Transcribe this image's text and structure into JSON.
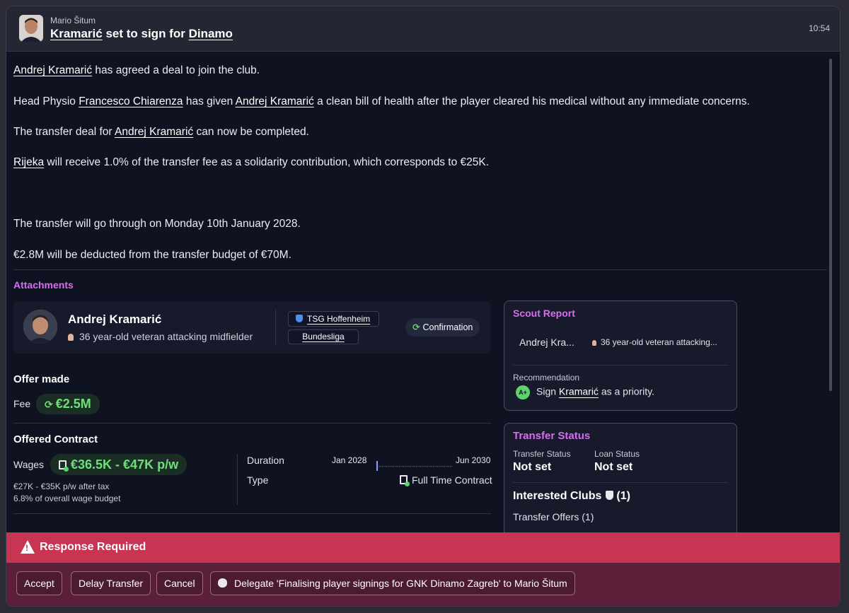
{
  "header": {
    "sender": "Mario Šitum",
    "title_player": "Kramarić",
    "title_middle": " set to sign for ",
    "title_club": "Dinamo",
    "time": "10:54"
  },
  "message": {
    "p1_link": "Andrej Kramarić",
    "p1_rest": " has agreed a deal to join the club.",
    "p2_pre": "Head Physio ",
    "p2_link1": "Francesco Chiarenza",
    "p2_mid": " has given ",
    "p2_link2": "Andrej Kramarić",
    "p2_rest": " a clean bill of health after the player cleared his medical without any immediate concerns.",
    "p3_pre": "The transfer deal for ",
    "p3_link": "Andrej Kramarić",
    "p3_rest": " can now be completed.",
    "p4_link": "Rijeka",
    "p4_rest": " will receive 1.0% of the transfer fee as a solidarity contribution, which corresponds to €25K.",
    "p5": "The transfer will go through on Monday 10th January 2028.",
    "p6": "€2.8M will be deducted from the transfer budget of €70M."
  },
  "attachments": {
    "title": "Attachments",
    "player_name": "Andrej Kramarić",
    "player_desc": "36 year-old veteran attacking midfielder",
    "club": "TSG Hoffenheim",
    "league": "Bundesliga",
    "status_chip": "Confirmation"
  },
  "offer": {
    "title": "Offer made",
    "fee_label": "Fee",
    "fee_value": "€2.5M",
    "contract_title": "Offered Contract",
    "wages_label": "Wages",
    "wages_value": "€36.5K - €47K p/w",
    "after_tax": "€27K - €35K p/w after tax",
    "wage_budget": "6.8% of overall wage budget",
    "duration_label": "Duration",
    "duration_start": "Jan 2028",
    "duration_end": "Jun 2030",
    "type_label": "Type",
    "type_value": "Full Time Contract"
  },
  "scout_report": {
    "title": "Scout Report",
    "player_short": "Andrej Kra...",
    "player_desc_short": "36 year-old veteran attacking...",
    "recommendation_label": "Recommendation",
    "grade": "A+",
    "rec_pre": "Sign ",
    "rec_link": "Kramarić",
    "rec_rest": " as a priority."
  },
  "transfer_status": {
    "title": "Transfer Status",
    "transfer_status_label": "Transfer Status",
    "transfer_status_value": "Not set",
    "loan_status_label": "Loan Status",
    "loan_status_value": "Not set",
    "interested_clubs": "Interested Clubs",
    "interested_count": "(1)",
    "transfer_offers": "Transfer Offers (1)"
  },
  "response": {
    "title": "Response Required",
    "accept": "Accept",
    "delay": "Delay Transfer",
    "cancel": "Cancel",
    "delegate": "Delegate 'Finalising player signings for GNK Dinamo Zagreb' to Mario Šitum"
  },
  "colors": {
    "accent_purple": "#d96cf2",
    "positive_green": "#6ee07a",
    "response_red": "#c73553"
  }
}
